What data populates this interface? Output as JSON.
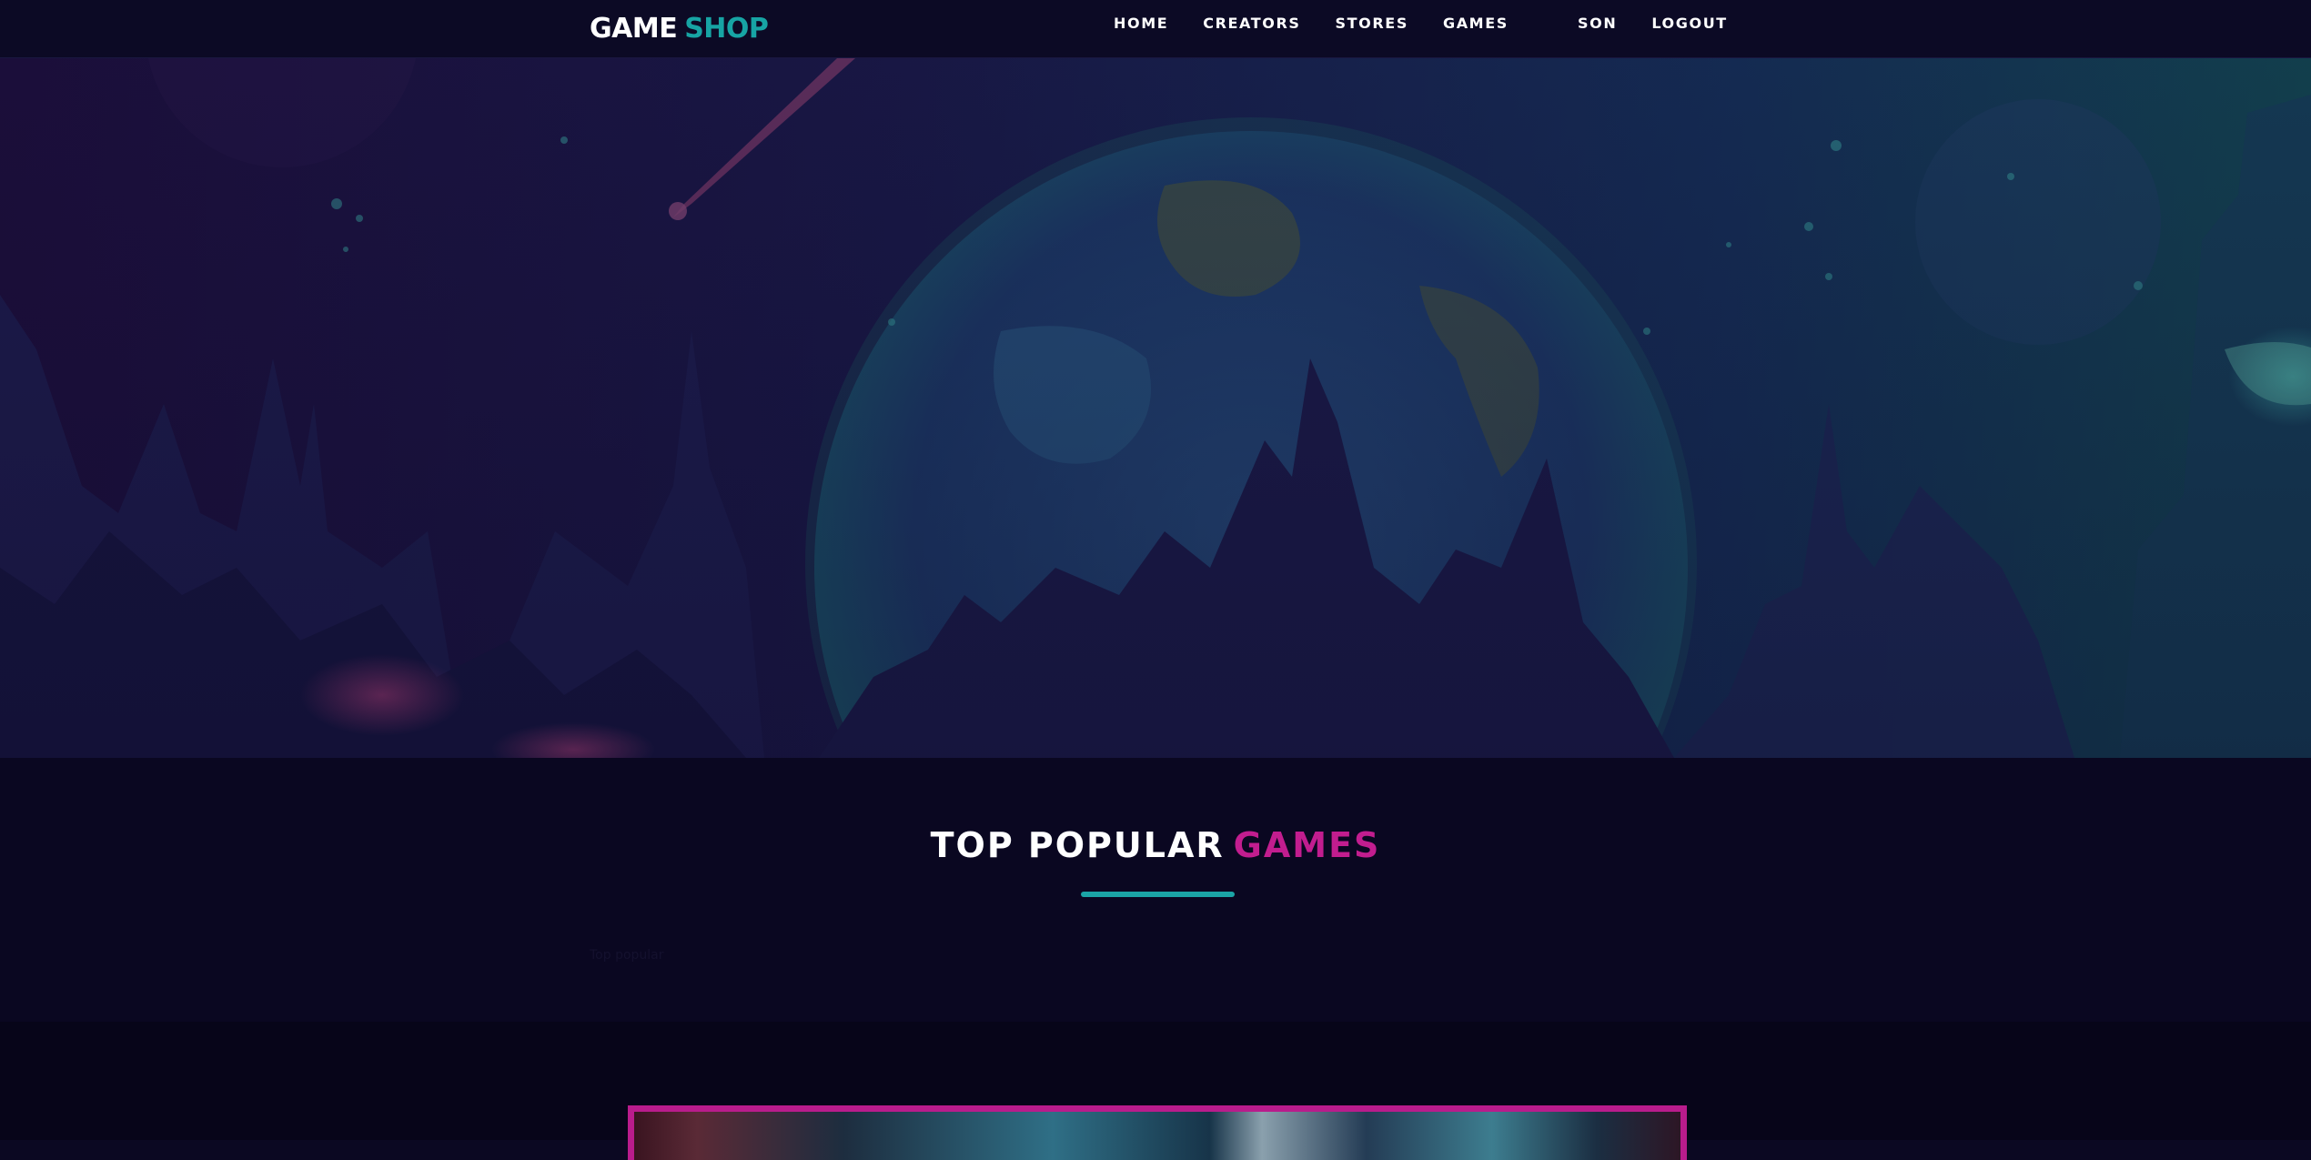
{
  "navbar": {
    "logo": {
      "word1": "GAME",
      "word2": "SHOP"
    },
    "links": [
      "HOME",
      "CREATORS",
      "STORES",
      "GAMES"
    ],
    "user_links": [
      "SON",
      "LOGOUT"
    ]
  },
  "hero": {
    "scene": "space-city-illustration"
  },
  "popular": {
    "title_part1": "TOP POPULAR",
    "title_part2": "GAMES",
    "faint_text": "Top popular"
  },
  "colors": {
    "accent_teal": "#17a4a4",
    "accent_magenta": "#c21d8f",
    "background": "#0b0822"
  }
}
